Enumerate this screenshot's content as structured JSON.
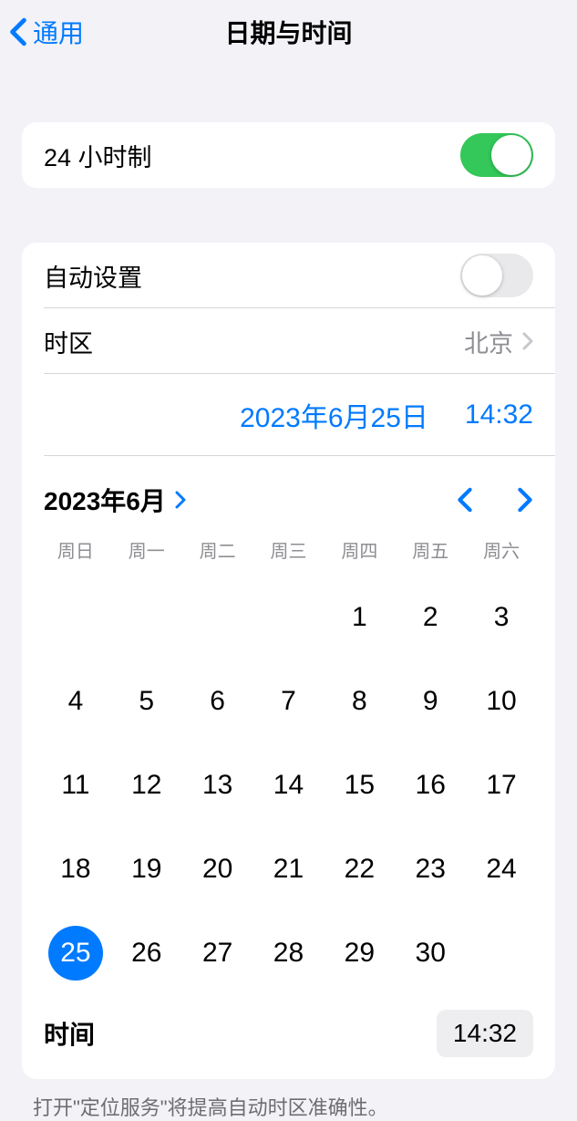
{
  "nav": {
    "back_label": "通用",
    "title": "日期与时间"
  },
  "settings": {
    "hour_format_label": "24 小时制",
    "hour_format_on": true,
    "auto_set_label": "自动设置",
    "auto_set_on": false,
    "timezone_label": "时区",
    "timezone_value": "北京"
  },
  "datetime": {
    "date_display": "2023年6月25日",
    "time_display": "14:32",
    "month_label": "2023年6月",
    "time_row_label": "时间",
    "time_row_value": "14:32"
  },
  "calendar": {
    "weekdays": [
      "周日",
      "周一",
      "周二",
      "周三",
      "周四",
      "周五",
      "周六"
    ],
    "leading_blanks": 4,
    "days": [
      1,
      2,
      3,
      4,
      5,
      6,
      7,
      8,
      9,
      10,
      11,
      12,
      13,
      14,
      15,
      16,
      17,
      18,
      19,
      20,
      21,
      22,
      23,
      24,
      25,
      26,
      27,
      28,
      29,
      30
    ],
    "selected_day": 25
  },
  "footer": {
    "note": "打开\"定位服务\"将提高自动时区准确性。"
  }
}
